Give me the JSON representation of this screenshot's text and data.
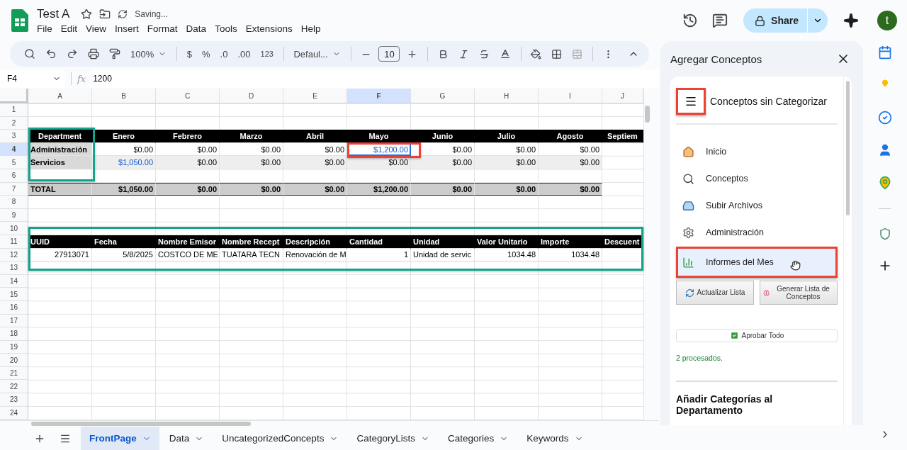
{
  "document": {
    "title": "Test A",
    "status": "Saving..."
  },
  "menu": [
    "File",
    "Edit",
    "View",
    "Insert",
    "Format",
    "Data",
    "Tools",
    "Extensions",
    "Help"
  ],
  "account": {
    "share": "Share",
    "avatar": "t"
  },
  "toolbar": {
    "zoom": "100%",
    "currency": "$",
    "percent": "%",
    "decrease_decimals": ".0",
    "increase_decimals": ".00",
    "number_format": "123",
    "font": "Defaul...",
    "font_size": "10"
  },
  "formula_bar": {
    "cell": "F4",
    "function_label": "fx",
    "formula": "1200"
  },
  "columns": [
    {
      "label": "A",
      "selected": false
    },
    {
      "label": "B",
      "selected": false
    },
    {
      "label": "C",
      "selected": false
    },
    {
      "label": "D",
      "selected": false
    },
    {
      "label": "E",
      "selected": false
    },
    {
      "label": "F",
      "selected": true
    },
    {
      "label": "G",
      "selected": false
    },
    {
      "label": "H",
      "selected": false
    },
    {
      "label": "I",
      "selected": false
    },
    {
      "label": "J",
      "selected": false
    }
  ],
  "rows": [
    {
      "number": "1",
      "selected": false
    },
    {
      "number": "2",
      "selected": false
    },
    {
      "number": "3",
      "selected": false,
      "kind": "header",
      "cells": [
        "Department",
        "Enero",
        "Febrero",
        "Marzo",
        "Abril",
        "Mayo",
        "Junio",
        "Julio",
        "Agosto",
        "Septiem"
      ]
    },
    {
      "number": "4",
      "selected": true,
      "kind": "data",
      "cells": [
        {
          "text": "Administración",
          "kind": "text"
        },
        {
          "text": "$0.00",
          "kind": "number"
        },
        {
          "text": "$0.00",
          "kind": "number"
        },
        {
          "text": "$0.00",
          "kind": "number"
        },
        {
          "text": "$0.00",
          "kind": "number"
        },
        {
          "text": "$1,200.00",
          "kind": "number",
          "color": "#1155cc"
        },
        {
          "text": "$0.00",
          "kind": "number"
        },
        {
          "text": "$0.00",
          "kind": "number"
        },
        {
          "text": "$0.00",
          "kind": "number"
        }
      ]
    },
    {
      "number": "5",
      "selected": false,
      "kind": "data-alt",
      "cells": [
        {
          "text": "Servicios",
          "kind": "text"
        },
        {
          "text": "$1,050.00",
          "kind": "number",
          "color": "#1155cc"
        },
        {
          "text": "$0.00",
          "kind": "number"
        },
        {
          "text": "$0.00",
          "kind": "number"
        },
        {
          "text": "$0.00",
          "kind": "number"
        },
        {
          "text": "$0.00",
          "kind": "number"
        },
        {
          "text": "$0.00",
          "kind": "number"
        },
        {
          "text": "$0.00",
          "kind": "number"
        },
        {
          "text": "$0.00",
          "kind": "number"
        }
      ]
    },
    {
      "number": "6",
      "selected": false
    },
    {
      "number": "7",
      "selected": false,
      "kind": "total",
      "cells": [
        {
          "text": "TOTAL",
          "kind": "text"
        },
        {
          "text": "$1,050.00",
          "kind": "number"
        },
        {
          "text": "$0.00",
          "kind": "number"
        },
        {
          "text": "$0.00",
          "kind": "number"
        },
        {
          "text": "$0.00",
          "kind": "number"
        },
        {
          "text": "$1,200.00",
          "kind": "number"
        },
        {
          "text": "$0.00",
          "kind": "number"
        },
        {
          "text": "$0.00",
          "kind": "number"
        },
        {
          "text": "$0.00",
          "kind": "number"
        }
      ]
    },
    {
      "number": "8",
      "selected": false
    },
    {
      "number": "9",
      "selected": false
    },
    {
      "number": "10",
      "selected": false
    },
    {
      "number": "11",
      "selected": false,
      "kind": "table-header",
      "cells": [
        "UUID",
        "Fecha",
        "Nombre Emisor",
        "Nombre Recept",
        "Descripción",
        "Cantidad",
        "Unidad",
        "Valor Unitario",
        "Importe",
        "Descuent"
      ]
    },
    {
      "number": "12",
      "selected": false,
      "kind": "table-row",
      "cells": [
        {
          "text": "27913071",
          "kind": "number"
        },
        {
          "text": "5/8/2025",
          "kind": "number"
        },
        {
          "text": "COSTCO DE ME",
          "kind": "text"
        },
        {
          "text": "TUATARA TECN",
          "kind": "text"
        },
        {
          "text": "Renovación de M",
          "kind": "text"
        },
        {
          "text": "1",
          "kind": "number"
        },
        {
          "text": "Unidad de servic",
          "kind": "text"
        },
        {
          "text": "1034.48",
          "kind": "number"
        },
        {
          "text": "1034.48",
          "kind": "number"
        }
      ]
    },
    {
      "number": "13",
      "selected": false
    },
    {
      "number": "14",
      "selected": false
    },
    {
      "number": "15",
      "selected": false
    },
    {
      "number": "16",
      "selected": false
    },
    {
      "number": "17",
      "selected": false
    },
    {
      "number": "18",
      "selected": false
    },
    {
      "number": "19",
      "selected": false
    },
    {
      "number": "20",
      "selected": false
    },
    {
      "number": "21",
      "selected": false
    },
    {
      "number": "22",
      "selected": false
    },
    {
      "number": "23",
      "selected": false
    },
    {
      "number": "24",
      "selected": false
    }
  ],
  "sheet_tabs": [
    {
      "label": "FrontPage",
      "selected": true
    },
    {
      "label": "Data",
      "selected": false
    },
    {
      "label": "UncategorizedConcepts",
      "selected": false
    },
    {
      "label": "CategoryLists",
      "selected": false
    },
    {
      "label": "Categories",
      "selected": false
    },
    {
      "label": "Keywords",
      "selected": false
    }
  ],
  "sidebar": {
    "title": "Agregar Conceptos",
    "heading": "Conceptos sin Categorizar",
    "nav": [
      {
        "label": "Inicio",
        "selected": false
      },
      {
        "label": "Conceptos",
        "selected": false
      },
      {
        "label": "Subir Archivos",
        "selected": false
      },
      {
        "label": "Administración",
        "selected": false
      },
      {
        "label": "Informes del Mes",
        "selected": true
      }
    ],
    "buttons": [
      "Actualizar Lista",
      "Generar Lista de Conceptos"
    ],
    "approve": "Aprobar Todo",
    "status": "2 procesados.",
    "section": "Añadir Categorías al Departamento"
  }
}
